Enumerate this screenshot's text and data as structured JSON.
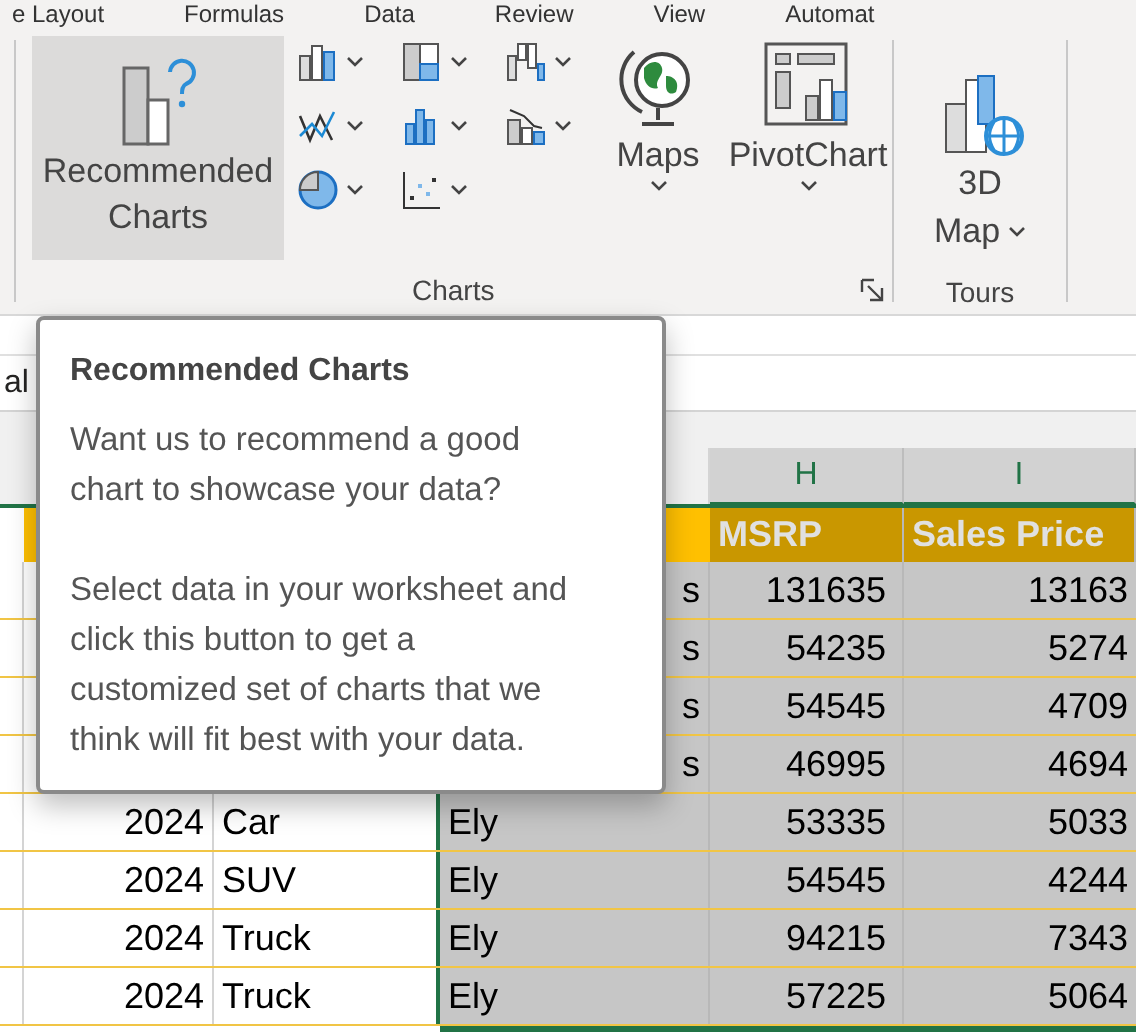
{
  "ribbon_tabs": [
    "e Layout",
    "Formulas",
    "Data",
    "Review",
    "View",
    "Automat"
  ],
  "charts_group": {
    "label": "Charts",
    "recommended": {
      "lines": [
        "Recommended",
        "Charts"
      ],
      "selected": true
    },
    "maps": "Maps",
    "pivot": "PivotChart"
  },
  "tours_group": {
    "label": "Tours",
    "map_lines": [
      "3D",
      "Map"
    ]
  },
  "name_box": "al",
  "columns": [
    {
      "label": "H",
      "selected": true
    },
    {
      "label": "I",
      "selected": true
    }
  ],
  "header_row": [
    "MSRP",
    "Sales Price"
  ],
  "rows": [
    {
      "year": "",
      "type": "",
      "dealer": "s",
      "msrp": "131635",
      "price": "13163"
    },
    {
      "year": "",
      "type": "",
      "dealer": "s",
      "msrp": "54235",
      "price": "5274"
    },
    {
      "year": "",
      "type": "",
      "dealer": "s",
      "msrp": "54545",
      "price": "4709"
    },
    {
      "year": "",
      "type": "",
      "dealer": "s",
      "msrp": "46995",
      "price": "4694"
    },
    {
      "year": "2024",
      "type": "Car",
      "dealer": "Ely",
      "msrp": "53335",
      "price": "5033"
    },
    {
      "year": "2024",
      "type": "SUV",
      "dealer": "Ely",
      "msrp": "54545",
      "price": "4244"
    },
    {
      "year": "2024",
      "type": "Truck",
      "dealer": "Ely",
      "msrp": "94215",
      "price": "7343"
    },
    {
      "year": "2024",
      "type": "Truck",
      "dealer": "Ely",
      "msrp": "57225",
      "price": "5064"
    }
  ],
  "tooltip": {
    "title": "Recommended Charts",
    "paragraphs": [
      "Want us to recommend a good chart to showcase your data?",
      "Select data in your worksheet and click this button to get a customized set of charts that we think will fit best with your data."
    ]
  }
}
